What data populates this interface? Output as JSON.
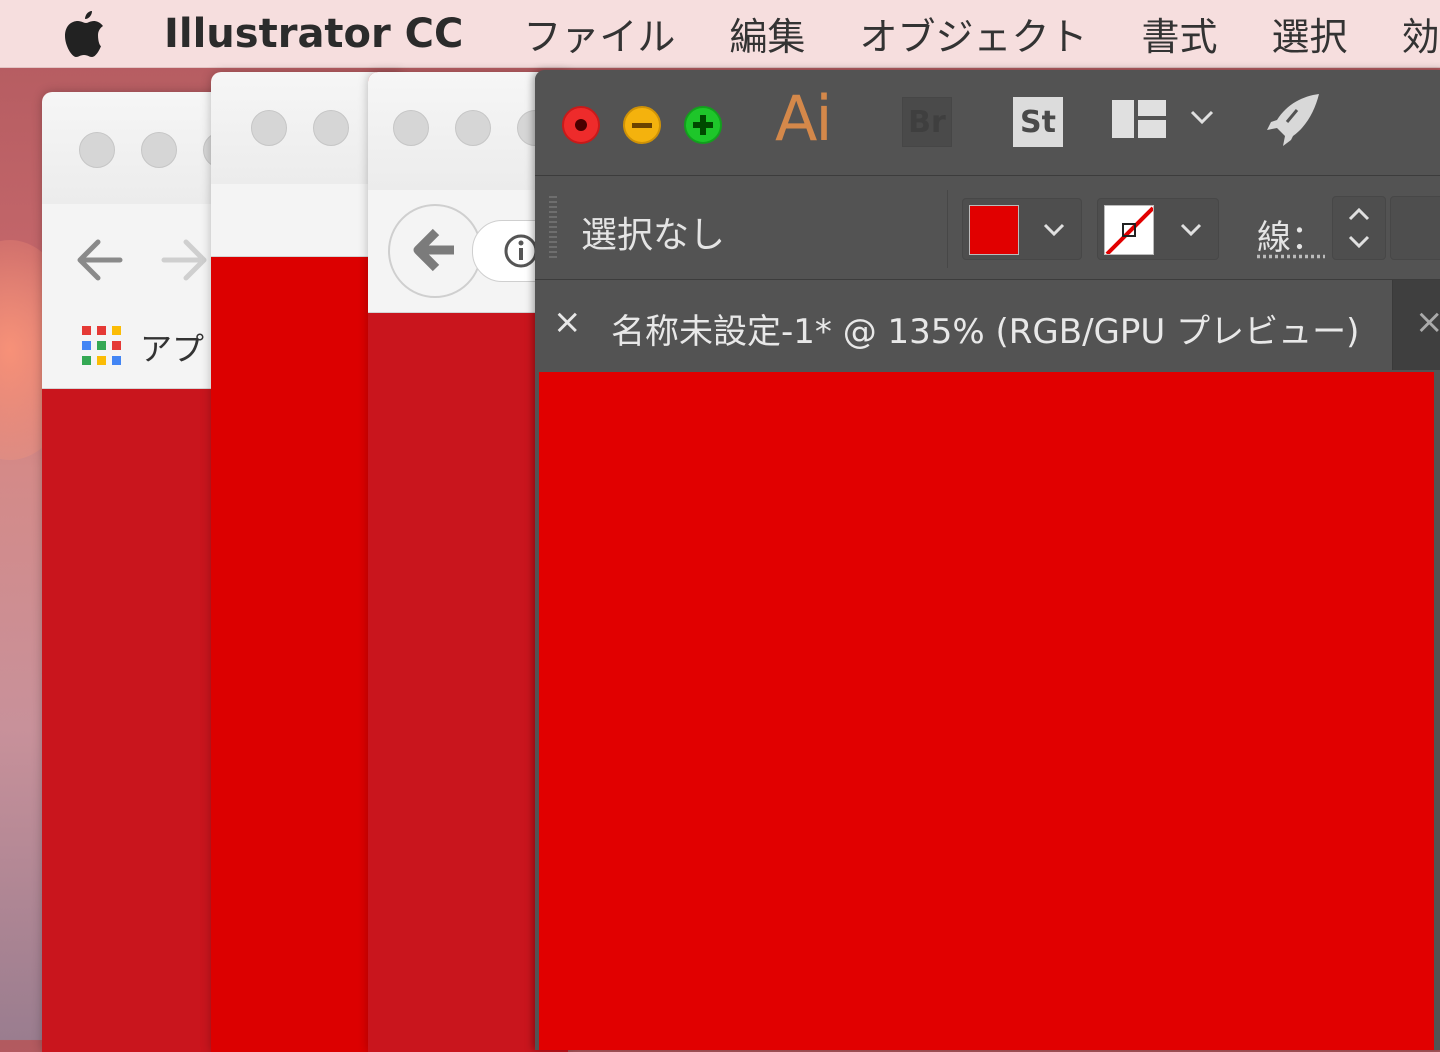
{
  "menubar": {
    "app_name": "Illustrator CC",
    "items": [
      "ファイル",
      "編集",
      "オブジェクト",
      "書式",
      "選択",
      "効"
    ]
  },
  "browser_windows": {
    "win1": {
      "bookmark_label": "アプ",
      "back_icon": "back-arrow-icon",
      "forward_icon": "forward-arrow-icon"
    },
    "win3": {
      "back_icon": "back-circle-icon",
      "info_icon": "info-icon"
    }
  },
  "illustrator": {
    "app_logo": "Ai",
    "bridge_label": "Br",
    "stock_label": "St",
    "control_bar": {
      "selection_label": "選択なし",
      "fill_color": "#e10000",
      "stroke_label": "線："
    },
    "document_tab": {
      "close_symbol": "×",
      "title": "名称未設定-1* @ 135% (RGB/GPU プレビュー)",
      "next_close_symbol": "×"
    },
    "canvas_color": "#e10000"
  },
  "colors": {
    "menubar_bg": "#f6dede",
    "ai_panel_bg": "#535353",
    "close_red": "#ee2b2b",
    "minimize_yellow": "#f4b20d",
    "zoom_green": "#1ec62a"
  }
}
